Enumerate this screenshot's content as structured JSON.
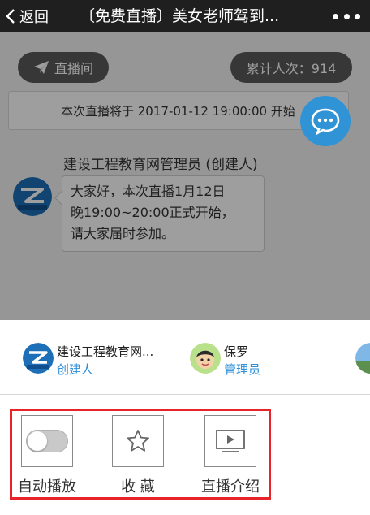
{
  "nav": {
    "back_label": "返回",
    "title": "〔免费直播〕美女老师驾到..."
  },
  "chat": {
    "room_label": "直播间",
    "visit_count_label": "累计人次：914",
    "notice": "本次直播将于 2017-01-12 19:00:00 开始",
    "sender_name": "建设工程教育网管理员 (创建人)",
    "message_lines": [
      "大家好，本次直播1月12日",
      "晚19:00~20:00正式开始，",
      "请大家届时参加。"
    ],
    "logo_text": "建设工程教育网"
  },
  "participants": [
    {
      "name": "建设工程教育网...",
      "role": "创建人"
    },
    {
      "name": "保罗",
      "role": "管理员"
    }
  ],
  "actions": {
    "autoplay_label": "自动播放",
    "autoplay_on": false,
    "favorite_label": "收 藏",
    "intro_label": "直播介绍"
  },
  "colors": {
    "accent": "#2f8fd8",
    "fab": "#2f93d6",
    "highlight_border": "#e8232a",
    "navbar": "#1f1f1f"
  }
}
